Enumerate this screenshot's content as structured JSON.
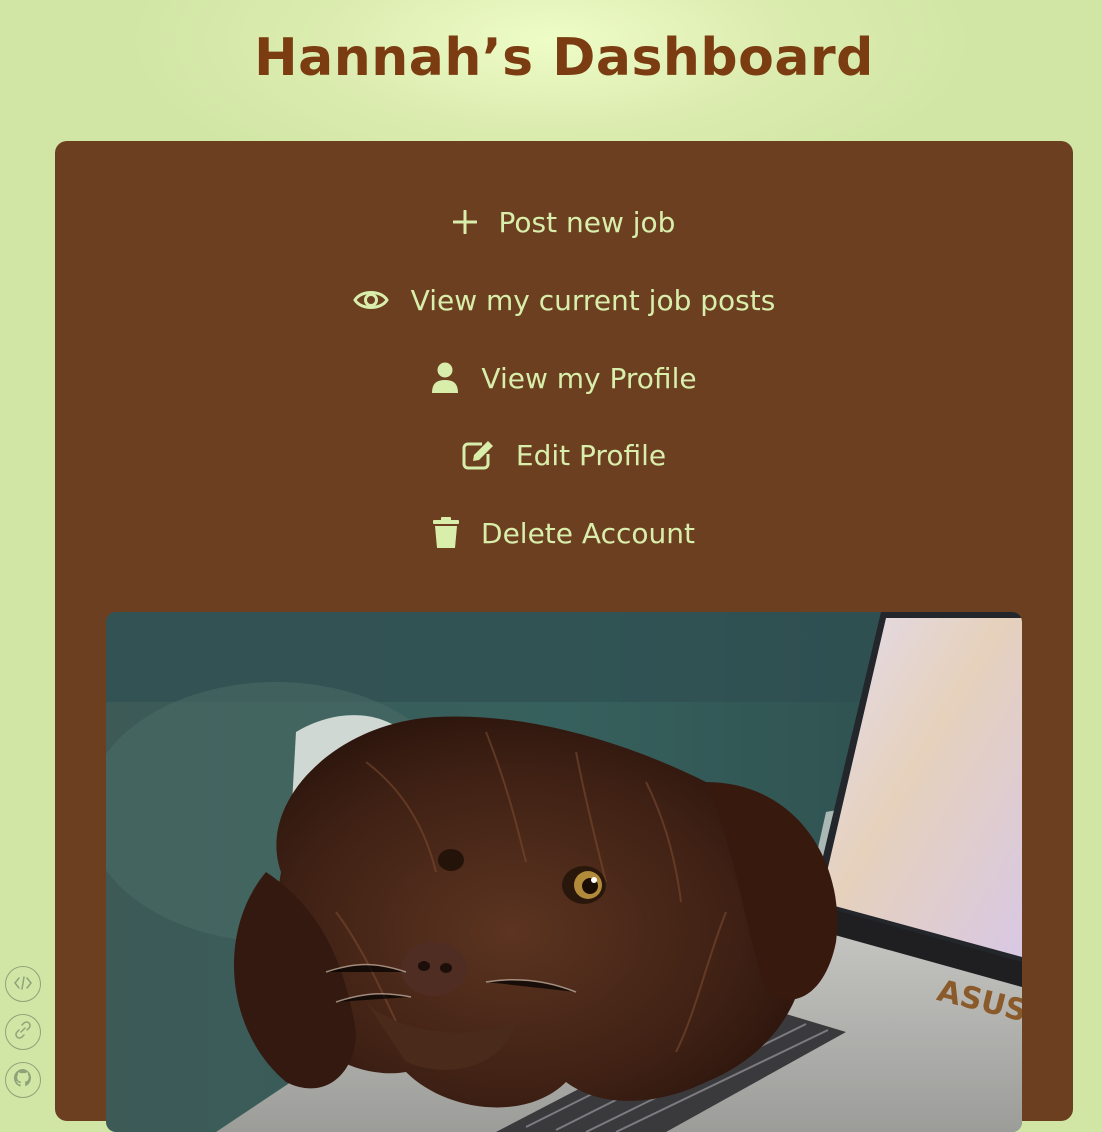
{
  "header": {
    "title": "Hannah’s Dashboard"
  },
  "menu": {
    "items": [
      {
        "label": "Post new job",
        "icon": "plus-icon"
      },
      {
        "label": "View my current job posts",
        "icon": "eye-icon"
      },
      {
        "label": "View my Profile",
        "icon": "user-icon"
      },
      {
        "label": "Edit Profile",
        "icon": "edit-icon"
      },
      {
        "label": "Delete Account",
        "icon": "trash-icon"
      }
    ]
  },
  "photo": {
    "subject": "dog-on-laptop-photo",
    "laptop_brand": "ASUS"
  },
  "side_links": [
    {
      "icon": "code-icon"
    },
    {
      "icon": "link-icon"
    },
    {
      "icon": "github-icon"
    }
  ],
  "colors": {
    "background": "#d1e6a5",
    "title": "#7a3c10",
    "card": "#6c3f21",
    "menu_text": "#d8eeaa"
  }
}
